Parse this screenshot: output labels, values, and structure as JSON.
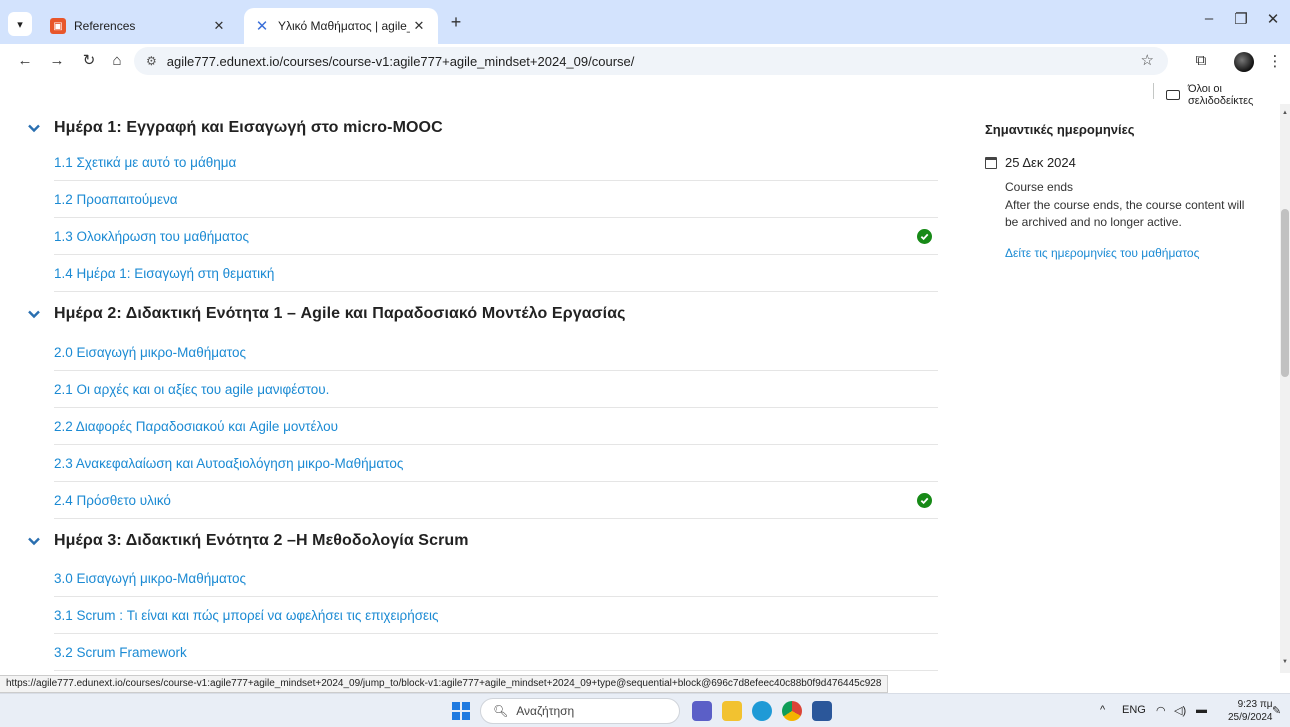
{
  "browser": {
    "tabs": [
      {
        "title": "References",
        "active": false
      },
      {
        "title": "Υλικό Μαθήματος | agile_mind",
        "active": true
      }
    ],
    "new_tab": "+",
    "address": "agile777.edunext.io/courses/course-v1:agile777+agile_mindset+2024_09/course/",
    "bookmarks_all": "Όλοι οι σελιδοδείκτες",
    "status_url": "https://agile777.edunext.io/courses/course-v1:agile777+agile_mindset+2024_09/jump_to/block-v1:agile777+agile_mindset+2024_09+type@sequential+block@696c7d8efeec40c88b0f9d476445c928"
  },
  "outline": [
    {
      "title": "Ημέρα 1: Εγγραφή και Εισαγωγή στο micro-MOOC",
      "units": [
        {
          "label": "1.1 Σχετικά με αυτό το μάθημα",
          "completed": false
        },
        {
          "label": "1.2 Προαπαιτούμενα",
          "completed": false
        },
        {
          "label": "1.3 Ολοκλήρωση του μαθήματος",
          "completed": true
        },
        {
          "label": "1.4 Ημέρα 1: Εισαγωγή στη θεματική",
          "completed": false
        }
      ]
    },
    {
      "title": "Ημέρα 2: Διδακτική Ενότητα 1 – Agile και Παραδοσιακό Μοντέλο Εργασίας",
      "units": [
        {
          "label": "2.0 Εισαγωγή μικρο-Μαθήματος",
          "completed": false
        },
        {
          "label": "2.1 Οι αρχές και οι αξίες του agile μανιφέστου.",
          "completed": false
        },
        {
          "label": "2.2 Διαφορές Παραδοσιακού και Agile μοντέλου",
          "completed": false
        },
        {
          "label": "2.3 Ανακεφαλαίωση και Αυτοαξιολόγηση μικρο-Μαθήματος",
          "completed": false
        },
        {
          "label": "2.4 Πρόσθετο υλικό",
          "completed": true
        }
      ]
    },
    {
      "title": "Ημέρα 3: Διδακτική Ενότητα 2 –Η Μεθοδολογία Scrum",
      "units": [
        {
          "label": "3.0 Εισαγωγή μικρο-Μαθήματος",
          "completed": false
        },
        {
          "label": "3.1 Scrum : Τι είναι και πώς μπορεί να ωφελήσει τις επιχειρήσεις",
          "completed": false
        },
        {
          "label": "3.2 Scrum Framework",
          "completed": false
        }
      ]
    }
  ],
  "sidebar": {
    "title": "Σημαντικές ημερομηνίες",
    "date": "25 Δεκ 2024",
    "kind": "Course ends",
    "description": "After the course ends, the course content will be archived and no longer active.",
    "link": "Δείτε τις ημερομηνίες του μαθήματος"
  },
  "taskbar": {
    "search_placeholder": "Αναζήτηση",
    "lang": "ENG",
    "time": "9:23 πμ",
    "date": "25/9/2024"
  },
  "colors": {
    "link": "#1b8ad3",
    "check": "#178a17",
    "tabbar": "#d3e3fd"
  }
}
